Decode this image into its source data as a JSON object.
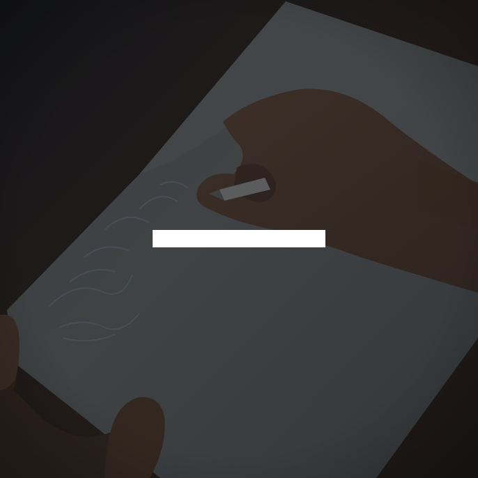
{
  "scene": {
    "description_colors": {
      "background": "#1f1a17",
      "table": "#2a2320",
      "paper": "#3a3d3e",
      "paper_highlight": "#454a4c",
      "skin": "#3b2d26",
      "skin_shadow": "#2a1f1a",
      "sketch_lines": "#4a5058",
      "redaction": "#ffffff"
    }
  }
}
